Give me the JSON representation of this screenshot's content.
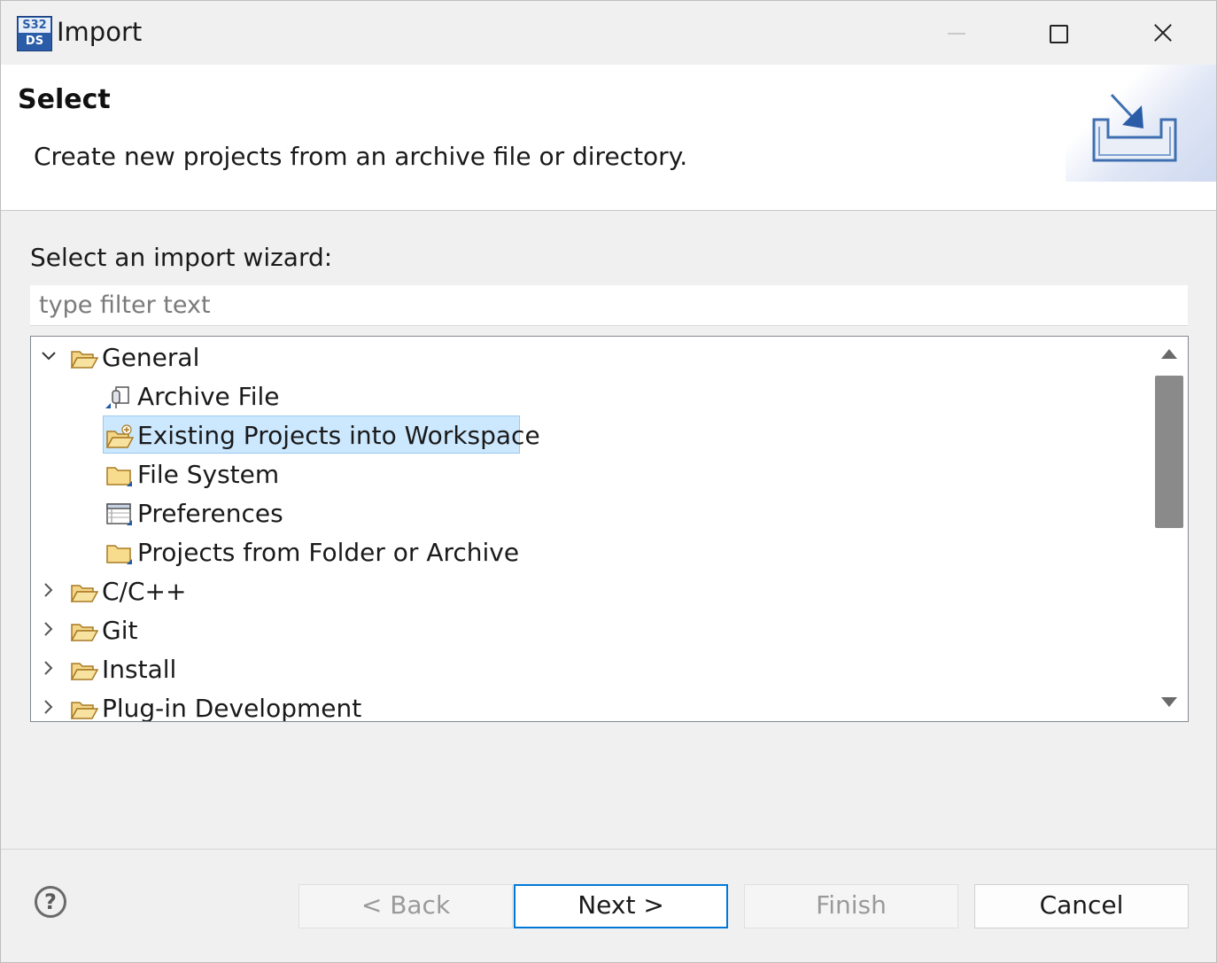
{
  "window": {
    "title": "Import",
    "app_icon_text_top": "S32",
    "app_icon_text_bottom": "DS"
  },
  "banner": {
    "title": "Select",
    "description": "Create new projects from an archive file or directory."
  },
  "wizard": {
    "label": "Select an import wizard:",
    "filter_placeholder": "type filter text",
    "filter_value": ""
  },
  "tree": {
    "items": [
      {
        "label": "General",
        "expanded": true,
        "icon": "open-folder-icon"
      },
      {
        "label": "Archive File",
        "icon": "archive-file-icon"
      },
      {
        "label": "Existing Projects into Workspace",
        "icon": "existing-projects-icon",
        "selected": true
      },
      {
        "label": "File System",
        "icon": "folder-icon"
      },
      {
        "label": "Preferences",
        "icon": "preferences-icon"
      },
      {
        "label": "Projects from Folder or Archive",
        "icon": "folder-icon"
      },
      {
        "label": "C/C++",
        "expanded": false,
        "icon": "open-folder-icon"
      },
      {
        "label": "Git",
        "expanded": false,
        "icon": "open-folder-icon"
      },
      {
        "label": "Install",
        "expanded": false,
        "icon": "open-folder-icon"
      },
      {
        "label": "Plug-in Development",
        "expanded": false,
        "icon": "open-folder-icon"
      }
    ]
  },
  "buttons": {
    "help": "?",
    "back": "< Back",
    "next": "Next >",
    "finish": "Finish",
    "cancel": "Cancel"
  },
  "colors": {
    "selection": "#cce8ff",
    "default_button_border": "#0078d7",
    "brand_icon": "#2a5ca8"
  }
}
